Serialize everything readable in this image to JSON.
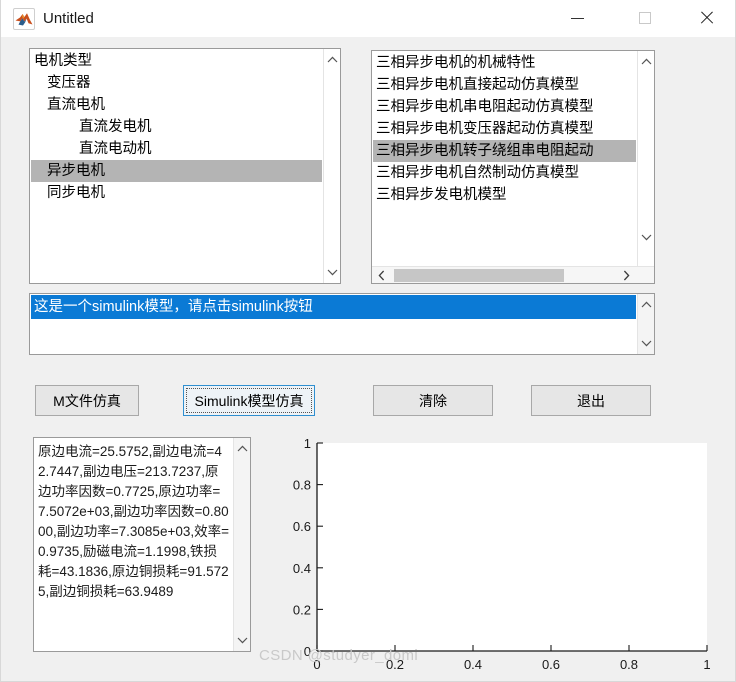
{
  "window": {
    "title": "Untitled",
    "icon": "matlab-membrane-icon",
    "background_color": "#f0f0f0",
    "controls": {
      "minimize": "─",
      "maximize": "□",
      "close": "✕"
    }
  },
  "motor_type_list": {
    "name": "motor-category-listbox",
    "items": [
      {
        "label": "电机类型",
        "indent": 0,
        "selected": false
      },
      {
        "label": "变压器",
        "indent": 1,
        "selected": false
      },
      {
        "label": "直流电机",
        "indent": 1,
        "selected": false
      },
      {
        "label": "直流发电机",
        "indent": 2,
        "selected": false
      },
      {
        "label": "直流电动机",
        "indent": 2,
        "selected": false
      },
      {
        "label": "异步电机",
        "indent": 1,
        "selected": true
      },
      {
        "label": "同步电机",
        "indent": 1,
        "selected": false
      }
    ],
    "selection_color": "#b4b4b4"
  },
  "model_list": {
    "name": "model-listbox",
    "items": [
      {
        "label": "三相异步电机的机械特性",
        "selected": false
      },
      {
        "label": "三相异步电机直接起动仿真模型",
        "selected": false
      },
      {
        "label": "三相异步电机串电阻起动仿真模型",
        "selected": false
      },
      {
        "label": "三相异步电机变压器起动仿真模型",
        "selected": false
      },
      {
        "label": "三相异步电机转子绕组串电阻起动",
        "selected": true
      },
      {
        "label": "三相异步电机自然制动仿真模型",
        "selected": false
      },
      {
        "label": "三相异步发电机模型",
        "selected": false
      }
    ],
    "selection_color": "#b4b4b4"
  },
  "message_list": {
    "name": "message-listbox",
    "items": [
      {
        "label": "这是一个simulink模型，请点击simulink按钮",
        "selected": true
      }
    ],
    "selection_color": "#0b7ad5"
  },
  "buttons": [
    {
      "name": "m-file-sim-button",
      "label": "M文件仿真",
      "focused": false
    },
    {
      "name": "simulink-sim-button",
      "label": "Simulink模型仿真",
      "focused": true
    },
    {
      "name": "clear-button",
      "label": "清除",
      "focused": false
    },
    {
      "name": "exit-button",
      "label": "退出",
      "focused": false
    }
  ],
  "results": {
    "name": "results-textbox",
    "text": "原边电流=25.5752,副边电流=42.7447,副边电压=213.7237,原边功率因数=0.7725,原边功率= 7.5072e+03,副边功率因数=0.8000,副边功率=7.3085e+03,效率=0.9735,励磁电流=1.1998,铁损耗=43.1836,原边铜损耗=91.5725,副边铜损耗=63.9489"
  },
  "watermark": "CSDN @studyer_domi",
  "chart_data": {
    "type": "line",
    "title": "",
    "xlabel": "",
    "ylabel": "",
    "xlim": [
      0,
      1
    ],
    "ylim": [
      0,
      1
    ],
    "xticks": [
      "0",
      "0.2",
      "0.4",
      "0.6",
      "0.8",
      "1"
    ],
    "yticks": [
      "0",
      "0.2",
      "0.4",
      "0.6",
      "0.8",
      "1"
    ],
    "grid": false,
    "series": [],
    "note": "empty MATLAB axes, no data plotted"
  }
}
